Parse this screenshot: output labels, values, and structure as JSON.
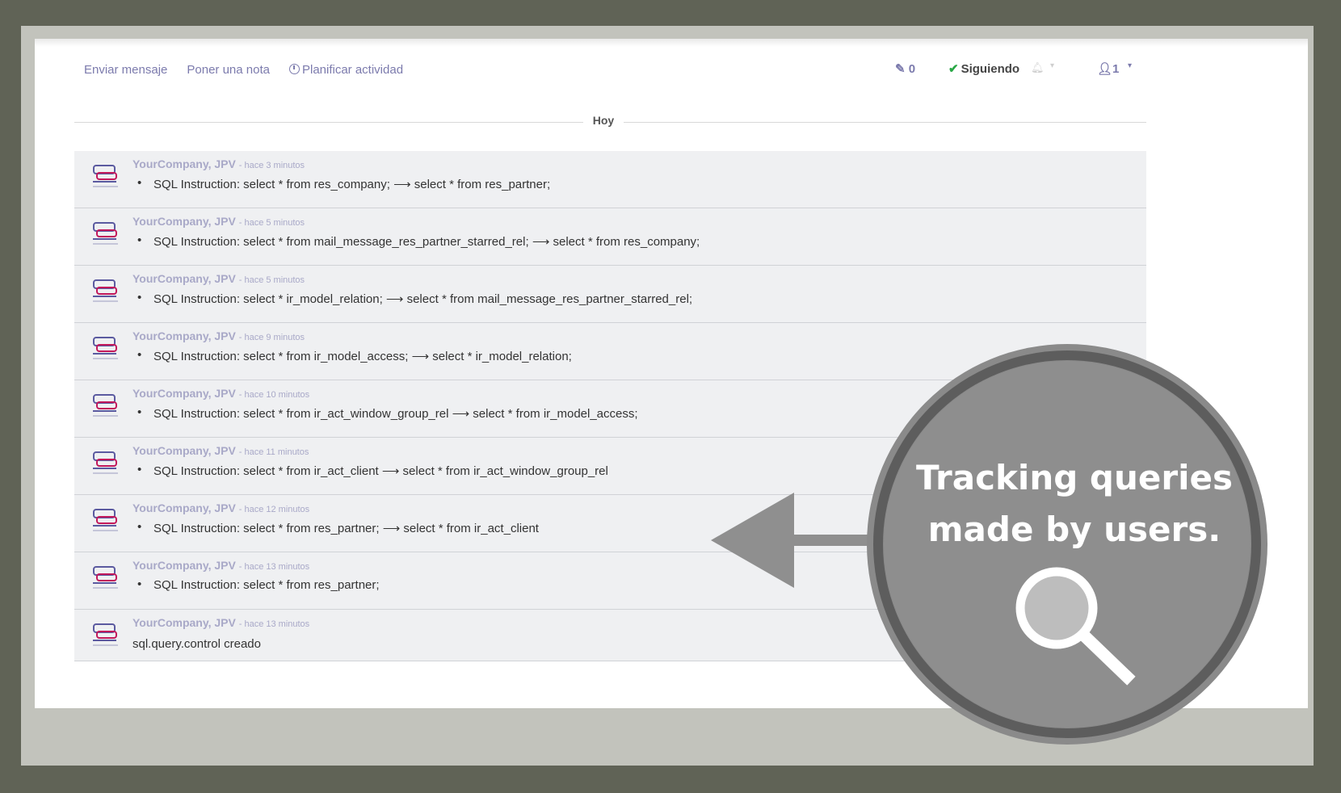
{
  "chatter_tabs": {
    "send_message": "Enviar mensaje",
    "log_note": "Poner una nota",
    "schedule_activity": "Planificar actividad"
  },
  "topbar": {
    "attachments_count": "0",
    "following_label": "Siguiendo",
    "followers_count": "1"
  },
  "separator": {
    "label": "Hoy"
  },
  "messages": [
    {
      "author": "YourCompany, JPV",
      "date": "- hace 3 minutos",
      "text": "SQL Instruction: select * from res_company; ⟶ select * from res_partner;"
    },
    {
      "author": "YourCompany, JPV",
      "date": "- hace 5 minutos",
      "text": "SQL Instruction: select * from mail_message_res_partner_starred_rel; ⟶ select * from res_company;"
    },
    {
      "author": "YourCompany, JPV",
      "date": "- hace 5 minutos",
      "text": "SQL Instruction: select * ir_model_relation; ⟶ select * from mail_message_res_partner_starred_rel;"
    },
    {
      "author": "YourCompany, JPV",
      "date": "- hace 9 minutos",
      "text": "SQL Instruction: select * from ir_model_access; ⟶ select * ir_model_relation;"
    },
    {
      "author": "YourCompany, JPV",
      "date": "- hace 10 minutos",
      "text": "SQL Instruction: select * from ir_act_window_group_rel ⟶ select * from ir_model_access;"
    },
    {
      "author": "YourCompany, JPV",
      "date": "- hace 11 minutos",
      "text": "SQL Instruction: select * from ir_act_client ⟶ select * from ir_act_window_group_rel"
    },
    {
      "author": "YourCompany, JPV",
      "date": "- hace 12 minutos",
      "text": "SQL Instruction: select * from res_partner; ⟶ select * from ir_act_client"
    },
    {
      "author": "YourCompany, JPV",
      "date": "- hace 13 minutos",
      "text": "SQL Instruction: select * from res_partner;"
    },
    {
      "author": "YourCompany, JPV",
      "date": "- hace 13 minutos",
      "text": "sql.query.control creado"
    }
  ],
  "callout": {
    "line1": "Tracking queries",
    "line2": "made by users."
  }
}
